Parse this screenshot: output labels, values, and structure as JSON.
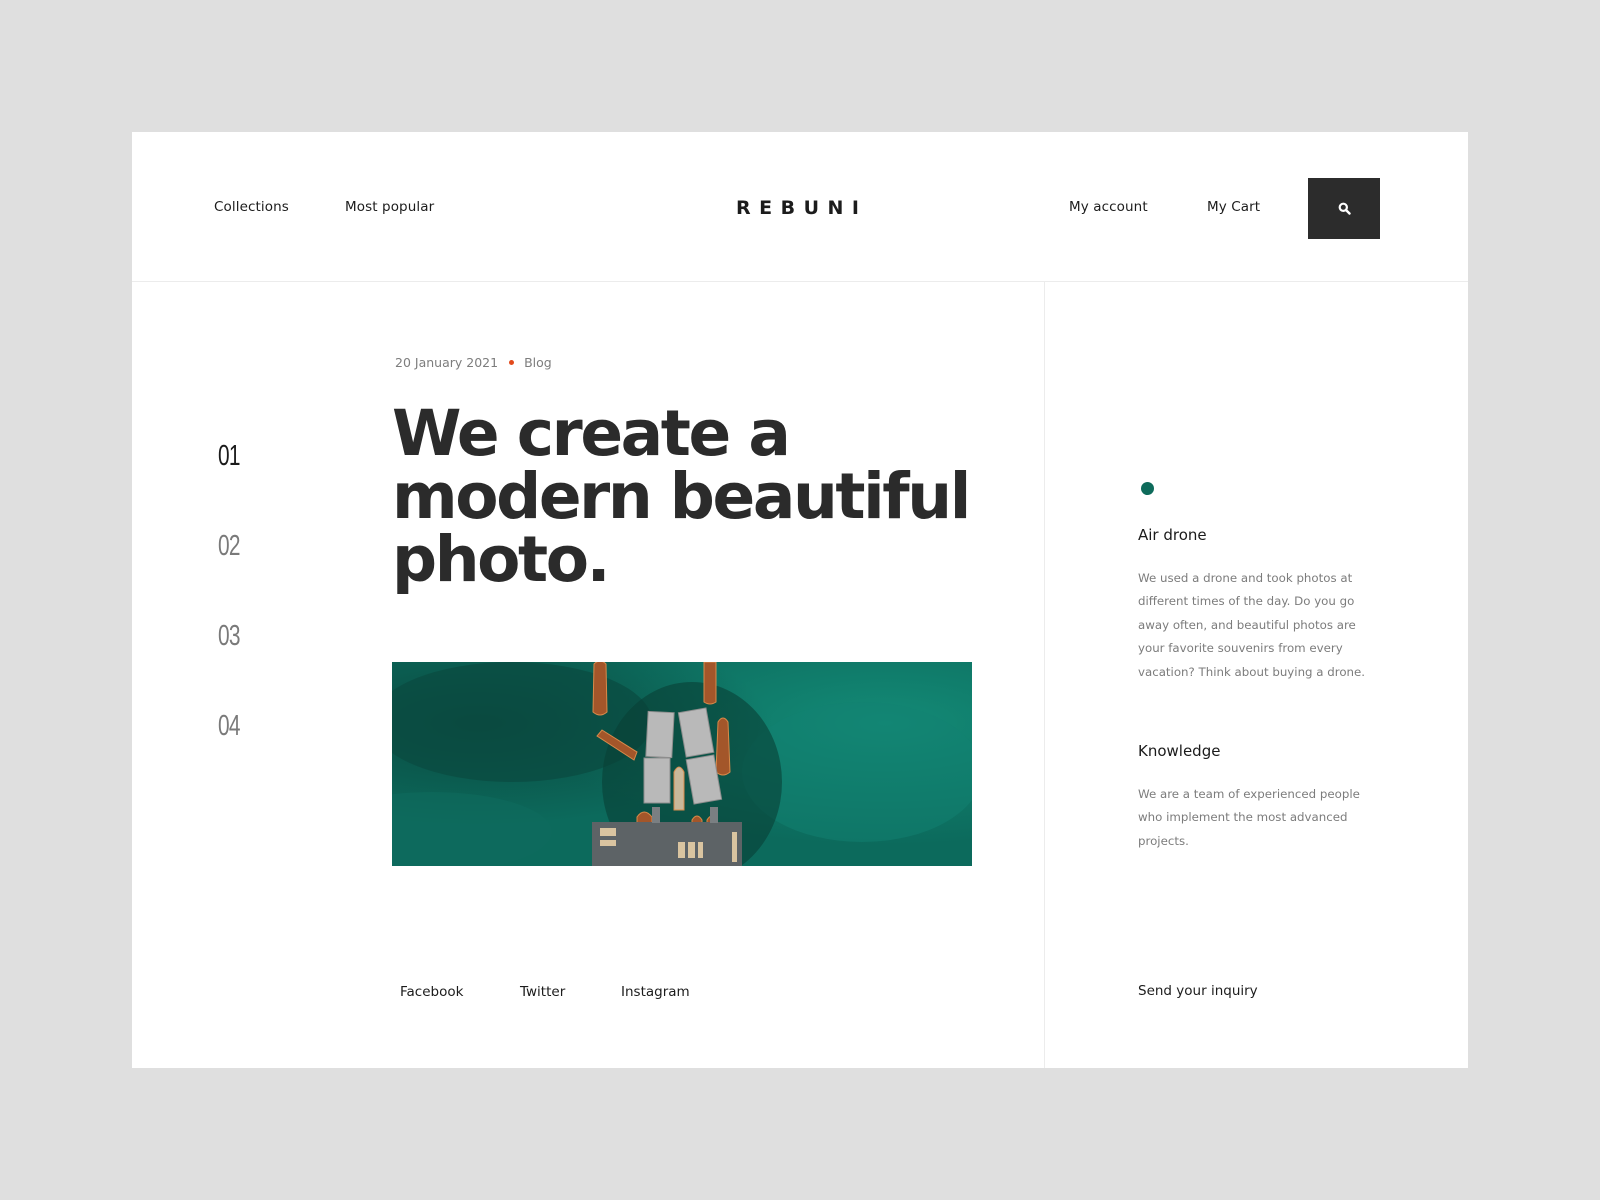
{
  "header": {
    "nav_left": [
      "Collections",
      "Most popular"
    ],
    "logo": "REBUNI",
    "nav_right": [
      "My account",
      "My Cart"
    ],
    "search_icon": "search-icon"
  },
  "slides": {
    "numbers": [
      "01",
      "02",
      "03",
      "04"
    ],
    "active_index": 0
  },
  "article": {
    "date": "20 January 2021",
    "category": "Blog",
    "headline": "We create a modern beautiful photo.",
    "image_alt": "Aerial view of a wooden pier with rowing boats on green water"
  },
  "social": [
    "Facebook",
    "Twitter",
    "Instagram"
  ],
  "sidebar": {
    "sections": [
      {
        "title": "Air drone",
        "text": "We used a drone and took photos at different times of the day. Do you go away often, and beautiful photos are your favorite souvenirs from every vacation? Think about buying a drone."
      },
      {
        "title": "Knowledge",
        "text": "We are a team of experienced people who implement the most advanced projects."
      }
    ],
    "cta": "Send your inquiry"
  },
  "colors": {
    "background": "#dfdfdf",
    "card": "#ffffff",
    "text_dark": "#2b2b2b",
    "text_muted": "#7c7c7c",
    "accent_dot": "#e24a1c",
    "teal": "#0e6b5b",
    "search_button": "#2c2c2c"
  }
}
